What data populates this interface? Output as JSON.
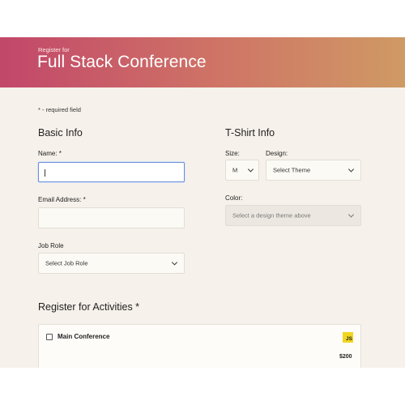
{
  "header": {
    "subtitle": "Register for",
    "title": "Full Stack Conference",
    "gradient_colors": [
      "#c2476a",
      "#cf7566",
      "#cf9a64"
    ]
  },
  "form": {
    "required_note": "* - required field",
    "basic_info": {
      "title": "Basic Info",
      "name_label": "Name: *",
      "name_value": "",
      "email_label": "Email Address: *",
      "email_value": "",
      "job_role_label": "Job Role",
      "job_role_value": "Select Job Role"
    },
    "tshirt_info": {
      "title": "T-Shirt Info",
      "size_label": "Size:",
      "size_value": "M",
      "design_label": "Design:",
      "design_value": "Select Theme",
      "color_label": "Color:",
      "color_value": "Select a design theme above"
    },
    "activities": {
      "title": "Register for Activities *",
      "items": [
        {
          "name": "Main Conference",
          "price": "$200",
          "icon": "JS",
          "checked": false
        }
      ]
    }
  },
  "colors": {
    "page_background": "#f6f1ea",
    "focus_border": "#6c8ed6",
    "js_badge": "#f2d51f"
  }
}
